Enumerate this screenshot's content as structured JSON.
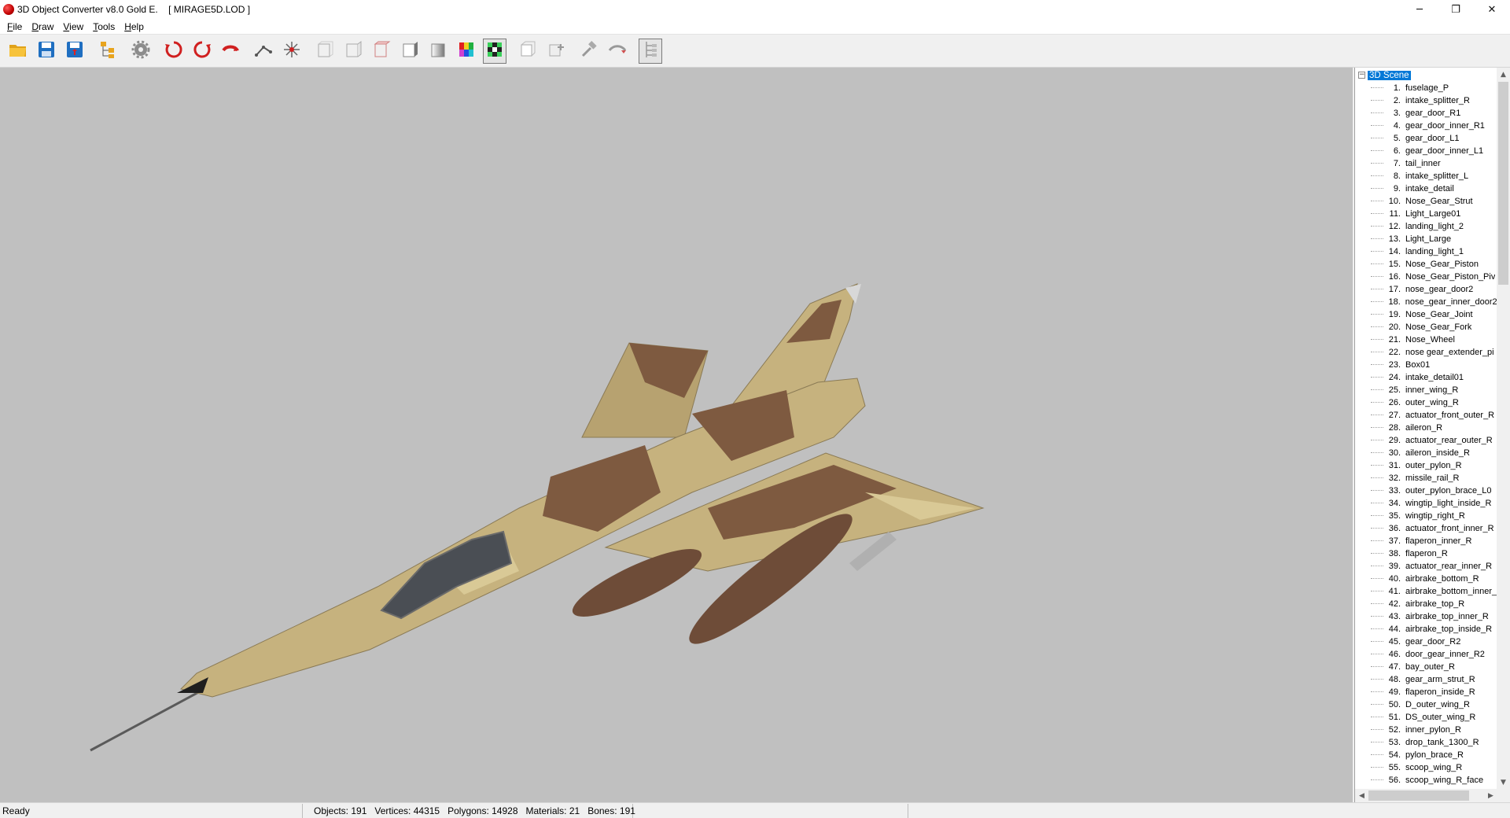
{
  "window": {
    "title": "3D Object Converter v8.0 Gold E.    [ MIRAGE5D.LOD ]",
    "controls": {
      "minimize": "─",
      "restore": "❐",
      "close": "✕"
    }
  },
  "menu": [
    {
      "label": "File",
      "accel": "F",
      "rest": "ile"
    },
    {
      "label": "Draw",
      "accel": "D",
      "rest": "raw"
    },
    {
      "label": "View",
      "accel": "V",
      "rest": "iew"
    },
    {
      "label": "Tools",
      "accel": "T",
      "rest": "ools"
    },
    {
      "label": "Help",
      "accel": "H",
      "rest": "elp"
    }
  ],
  "toolbar_icons": [
    "open-folder-icon",
    "save-icon",
    "save-as-icon",
    "scene-tree-icon",
    "settings-gear-icon",
    "rotate-x-icon",
    "rotate-y-icon",
    "rotate-z-icon",
    "bones-icon",
    "explode-icon",
    "view-front-icon",
    "view-side-icon",
    "view-top-icon",
    "solid-shade-icon",
    "smooth-shade-icon",
    "color-palette-icon",
    "texture-checker-icon",
    "box-select-icon",
    "box-move-icon",
    "tool-hammer-icon",
    "animation-icon",
    "hierarchy-icon"
  ],
  "viewport": {
    "background": "#c0c0c0",
    "model_colors": {
      "tan": "#c6b27e",
      "light_tan": "#d9c996",
      "brown": "#7e5a40",
      "canopy": "#4a4e54",
      "tank": "#6e4c38"
    }
  },
  "tree": {
    "root_label": "3D Scene",
    "items": [
      {
        "num": "1.",
        "name": "fuselage_P"
      },
      {
        "num": "2.",
        "name": "intake_splitter_R"
      },
      {
        "num": "3.",
        "name": "gear_door_R1"
      },
      {
        "num": "4.",
        "name": "gear_door_inner_R1"
      },
      {
        "num": "5.",
        "name": "gear_door_L1"
      },
      {
        "num": "6.",
        "name": "gear_door_inner_L1"
      },
      {
        "num": "7.",
        "name": "tail_inner"
      },
      {
        "num": "8.",
        "name": "intake_splitter_L"
      },
      {
        "num": "9.",
        "name": "intake_detail"
      },
      {
        "num": "10.",
        "name": "Nose_Gear_Strut"
      },
      {
        "num": "11.",
        "name": "Light_Large01"
      },
      {
        "num": "12.",
        "name": "landing_light_2"
      },
      {
        "num": "13.",
        "name": "Light_Large"
      },
      {
        "num": "14.",
        "name": "landing_light_1"
      },
      {
        "num": "15.",
        "name": "Nose_Gear_Piston"
      },
      {
        "num": "16.",
        "name": "Nose_Gear_Piston_Piv"
      },
      {
        "num": "17.",
        "name": "nose_gear_door2"
      },
      {
        "num": "18.",
        "name": "nose_gear_inner_door2"
      },
      {
        "num": "19.",
        "name": "Nose_Gear_Joint"
      },
      {
        "num": "20.",
        "name": "Nose_Gear_Fork"
      },
      {
        "num": "21.",
        "name": "Nose_Wheel"
      },
      {
        "num": "22.",
        "name": "nose gear_extender_pi"
      },
      {
        "num": "23.",
        "name": "Box01"
      },
      {
        "num": "24.",
        "name": "intake_detail01"
      },
      {
        "num": "25.",
        "name": "inner_wing_R"
      },
      {
        "num": "26.",
        "name": "outer_wing_R"
      },
      {
        "num": "27.",
        "name": "actuator_front_outer_R"
      },
      {
        "num": "28.",
        "name": "aileron_R"
      },
      {
        "num": "29.",
        "name": "actuator_rear_outer_R"
      },
      {
        "num": "30.",
        "name": "aileron_inside_R"
      },
      {
        "num": "31.",
        "name": "outer_pylon_R"
      },
      {
        "num": "32.",
        "name": "missile_rail_R"
      },
      {
        "num": "33.",
        "name": "outer_pylon_brace_L0"
      },
      {
        "num": "34.",
        "name": "wingtip_light_inside_R"
      },
      {
        "num": "35.",
        "name": "wingtip_right_R"
      },
      {
        "num": "36.",
        "name": "actuator_front_inner_R"
      },
      {
        "num": "37.",
        "name": "flaperon_inner_R"
      },
      {
        "num": "38.",
        "name": "flaperon_R"
      },
      {
        "num": "39.",
        "name": "actuator_rear_inner_R"
      },
      {
        "num": "40.",
        "name": "airbrake_bottom_R"
      },
      {
        "num": "41.",
        "name": "airbrake_bottom_inner_"
      },
      {
        "num": "42.",
        "name": "airbrake_top_R"
      },
      {
        "num": "43.",
        "name": "airbrake_top_inner_R"
      },
      {
        "num": "44.",
        "name": "airbrake_top_inside_R"
      },
      {
        "num": "45.",
        "name": "gear_door_R2"
      },
      {
        "num": "46.",
        "name": "door_gear_inner_R2"
      },
      {
        "num": "47.",
        "name": "bay_outer_R"
      },
      {
        "num": "48.",
        "name": "gear_arm_strut_R"
      },
      {
        "num": "49.",
        "name": "flaperon_inside_R"
      },
      {
        "num": "50.",
        "name": "D_outer_wing_R"
      },
      {
        "num": "51.",
        "name": "DS_outer_wing_R"
      },
      {
        "num": "52.",
        "name": "inner_pylon_R"
      },
      {
        "num": "53.",
        "name": "drop_tank_1300_R"
      },
      {
        "num": "54.",
        "name": "pylon_brace_R"
      },
      {
        "num": "55.",
        "name": "scoop_wing_R"
      },
      {
        "num": "56.",
        "name": "scoop_wing_R_face"
      }
    ]
  },
  "status": {
    "ready": "Ready",
    "stats": "Objects: 191   Vertices: 44315   Polygons: 14928   Materials: 21   Bones: 191"
  }
}
